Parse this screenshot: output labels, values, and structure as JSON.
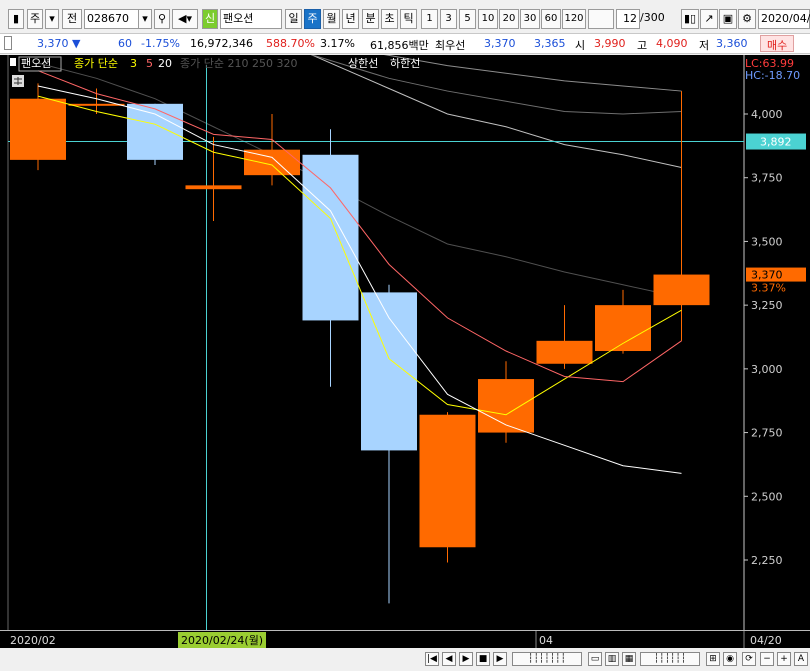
{
  "toolbar": {
    "mode_label": "주",
    "jeon_label": "전",
    "code_value": "028670",
    "sin_label": "신",
    "name_value": "팬오션",
    "period_tabs": [
      "일",
      "주",
      "월",
      "년"
    ],
    "active_period": "주",
    "intraday_tabs": [
      "분",
      "초",
      "틱"
    ],
    "number_tabs": [
      "1",
      "3",
      "5",
      "10",
      "20",
      "30",
      "60",
      "120"
    ],
    "count_value": "12",
    "count_total": "/300",
    "date_value": "2020/04/"
  },
  "quote": {
    "price": "3,370",
    "direction": "▼",
    "change": "60",
    "change_pct": "-1.75%",
    "volume": "16,972,346",
    "volume_ratio": "588.70%",
    "turnover_pct": "3.17%",
    "amount": "61,856백만",
    "best_label": "최우선",
    "best_ask": "3,370",
    "best_bid": "3,365",
    "open_label": "시",
    "open": "3,990",
    "high_label": "고",
    "high": "4,090",
    "low_label": "저",
    "low": "3,360",
    "buy_label": "매수"
  },
  "chart_data": {
    "type": "candlestick",
    "legend": {
      "name": "팬오션",
      "ma_label": "종가 단순",
      "ma_periods": [
        "3",
        "5",
        "20"
      ],
      "ma_colors": [
        "#ffff00",
        "#ff6666",
        "#ffffff"
      ],
      "faded_text": "종가 단순 210 250 320",
      "limit_labels": [
        "상한선",
        "하한선"
      ]
    },
    "x": [
      "2020/02/03",
      "2020/02/10",
      "2020/02/17",
      "2020/02/24",
      "2020/03/02",
      "2020/03/09",
      "2020/03/16",
      "2020/03/23",
      "2020/03/30",
      "2020/04/06",
      "2020/04/13",
      "2020/04/20"
    ],
    "candles": [
      {
        "open": 3820,
        "high": 4120,
        "low": 3780,
        "close": 4060
      },
      {
        "open": 4035,
        "high": 4100,
        "low": 4000,
        "close": 4040
      },
      {
        "open": 4040,
        "high": 4040,
        "low": 3800,
        "close": 3820
      },
      {
        "open": 3705,
        "high": 3910,
        "low": 3580,
        "close": 3720
      },
      {
        "open": 3760,
        "high": 4000,
        "low": 3720,
        "close": 3860
      },
      {
        "open": 3840,
        "high": 3940,
        "low": 2930,
        "close": 3190
      },
      {
        "open": 3300,
        "high": 3330,
        "low": 2080,
        "close": 2680
      },
      {
        "open": 2300,
        "high": 2830,
        "low": 2240,
        "close": 2820
      },
      {
        "open": 2750,
        "high": 3030,
        "low": 2710,
        "close": 2960
      },
      {
        "open": 3020,
        "high": 3250,
        "low": 3000,
        "close": 3110
      },
      {
        "open": 3070,
        "high": 3310,
        "low": 3060,
        "close": 3250
      },
      {
        "open": 3250,
        "high": 4090,
        "low": 3110,
        "close": 3370
      }
    ],
    "series": [
      {
        "name": "3",
        "color": "#ffff00",
        "values": [
          4070,
          4010,
          3960,
          3850,
          3800,
          3590,
          3040,
          2860,
          2820,
          2960,
          3100,
          3230
        ]
      },
      {
        "name": "5",
        "color": "#ff6666",
        "values": [
          4170,
          4080,
          4020,
          3920,
          3900,
          3710,
          3410,
          3200,
          3070,
          2970,
          2950,
          3110
        ]
      },
      {
        "name": "20",
        "color": "#ffffff",
        "values": [
          4110,
          4060,
          4000,
          3880,
          3830,
          3620,
          3200,
          2900,
          2780,
          2700,
          2620,
          2590
        ]
      }
    ],
    "faded_series": [
      {
        "color": "#c0c0c0",
        "values": [
          4580,
          4510,
          4450,
          4380,
          4300,
          4200,
          4100,
          4000,
          3950,
          3880,
          3840,
          3790
        ]
      },
      {
        "color": "#8c8c8c",
        "values": [
          4520,
          4470,
          4420,
          4380,
          4320,
          4270,
          4230,
          4190,
          4160,
          4130,
          4110,
          4090
        ]
      },
      {
        "color": "#6e6e6e",
        "values": [
          4460,
          4410,
          4370,
          4330,
          4280,
          4210,
          4140,
          4090,
          4050,
          4010,
          4000,
          4010
        ]
      },
      {
        "color": "#505050",
        "values": [
          4200,
          4140,
          4060,
          3950,
          3840,
          3720,
          3600,
          3490,
          3440,
          3380,
          3330,
          3280
        ]
      }
    ],
    "ylim": [
      2000,
      4200
    ],
    "y_ticks": [
      "4,000",
      "3,750",
      "3,500",
      "3,250",
      "3,000",
      "2,750",
      "2,500",
      "2,250"
    ],
    "crosshair_value": "3,892",
    "last_price_label": "3,370",
    "last_pct_label": "3.37%",
    "lc_label": "LC:63.99",
    "hc_label": "HC:-18.70",
    "x_labels": [
      "2020/02",
      "2020/02/24(월)",
      "04",
      "04/20"
    ],
    "up_color": "#ff6a00",
    "down_color": "#a8d4ff",
    "crosshair_color": "#4bd2d2"
  }
}
